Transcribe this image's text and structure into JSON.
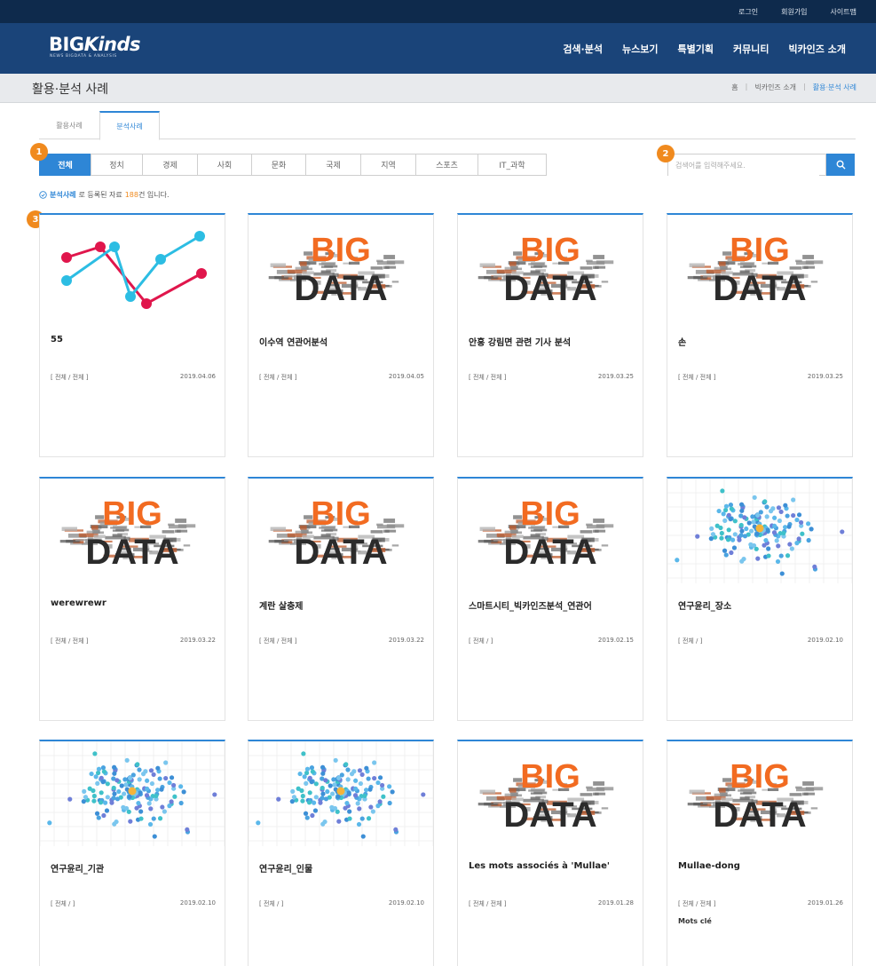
{
  "util_bar": {
    "links": [
      "로그인",
      "회원가입",
      "사이트맵"
    ]
  },
  "logo": {
    "main": "BIG",
    "main_italic": "Kinds",
    "sub": "NEWS BIGDATA & ANALYSIS"
  },
  "main_menu": [
    "검색·분석",
    "뉴스보기",
    "특별기획",
    "커뮤니티",
    "빅카인즈 소개"
  ],
  "page": {
    "title": "활용·분석 사례",
    "breadcrumb": [
      "홈",
      "빅카인즈 소개",
      "활용·분석 사례"
    ]
  },
  "tabs": [
    "활용사례",
    "분석사례"
  ],
  "categories": [
    "전체",
    "정치",
    "경제",
    "사회",
    "문화",
    "국제",
    "지역",
    "스포츠",
    "IT_과학"
  ],
  "badges": [
    "1",
    "2",
    "3"
  ],
  "search": {
    "placeholder": "검색어를 입력해주세요."
  },
  "count": {
    "label": "분석사례",
    "prefix": "로 등록된 자료",
    "number": "188",
    "suffix": "건 입니다."
  },
  "thumbnail_text": {
    "big": "BIG",
    "data": "DATA"
  },
  "cards": [
    {
      "title": "55",
      "category": "[ 전체 / 전체 ]",
      "date": "2019.04.06",
      "thumb": "linechart"
    },
    {
      "title": "이수역 연관어분석",
      "category": "[ 전체 / 전체 ]",
      "date": "2019.04.05",
      "thumb": "bigdata"
    },
    {
      "title": "안홍 강림면 관련 기사 분석",
      "category": "[ 전체 / 전체 ]",
      "date": "2019.03.25",
      "thumb": "bigdata"
    },
    {
      "title": "손",
      "category": "[ 전체 / 전체 ]",
      "date": "2019.03.25",
      "thumb": "bigdata"
    },
    {
      "title": "werewrewr",
      "category": "[ 전체 / 전체 ]",
      "date": "2019.03.22",
      "thumb": "bigdata"
    },
    {
      "title": "계란 살충제",
      "category": "[ 전체 / 전체 ]",
      "date": "2019.03.22",
      "thumb": "bigdata"
    },
    {
      "title": "스마트시티_빅카인즈분석_연관어",
      "category": "[ 전체 / ]",
      "date": "2019.02.15",
      "thumb": "bigdata"
    },
    {
      "title": "연구윤리_장소",
      "category": "[ 전체 / ]",
      "date": "2019.02.10",
      "thumb": "network"
    },
    {
      "title": "연구윤리_기관",
      "category": "[ 전체 / ]",
      "date": "2019.02.10",
      "thumb": "network"
    },
    {
      "title": "연구윤리_인물",
      "category": "[ 전체 / ]",
      "date": "2019.02.10",
      "thumb": "network"
    },
    {
      "title": "Les mots associés à 'Mullae'",
      "category": "[ 전체 / 전체 ]",
      "date": "2019.01.28",
      "thumb": "bigdata"
    },
    {
      "title": "Mullae-dong",
      "category": "[ 전체 / 전체 ]",
      "date": "2019.01.26",
      "thumb": "bigdata",
      "extra": "Mots clé"
    }
  ],
  "colors": {
    "nav": "#1a4479",
    "util": "#0e2a4c",
    "accent": "#2e86d6",
    "badge": "#f08a1e",
    "big_orange": "#f26b21",
    "line_red": "#e0164c",
    "line_cyan": "#2cbde3"
  },
  "icons": {
    "search": "search-icon",
    "check": "check-circle-icon"
  }
}
